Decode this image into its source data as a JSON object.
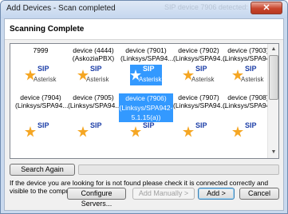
{
  "window": {
    "title": "Add Devices - Scan completed",
    "ghost_text": "SIP device 7906 detected: (Linksys...",
    "close_label": "✕"
  },
  "header": {
    "title": "Scanning Complete"
  },
  "device_icon": {
    "sip": "SIP",
    "brand": "Asterisk"
  },
  "devices": [
    {
      "label": "7999",
      "label2": ""
    },
    {
      "label": "device (4444)",
      "label2": "(AskoziaPBX)"
    },
    {
      "label": "device (7901)",
      "label2": "(Linksys/SPA94..."
    },
    {
      "label": "device (7902)",
      "label2": "(Linksys/SPA94..."
    },
    {
      "label": "device (7903)",
      "label2": "(Linksys/SPA94..."
    },
    {
      "label": "device (7904)",
      "label2": "(Linksys/SPA94..."
    },
    {
      "label": "device (7905)",
      "label2": "(Linksys/SPA94..."
    },
    {
      "label": "device (7906)",
      "label2": "(Linksys/SPA942-",
      "label3": "5.1.15(a))",
      "selected": true
    },
    {
      "label": "device (7907)",
      "label2": "(Linksys/SPA94..."
    },
    {
      "label": "device (7908)",
      "label2": "(Linksys/SPA94..."
    }
  ],
  "search_button": "Search Again",
  "help_text": "If the device you are looking for is not found please check it is connected correctly and visible to the computer.",
  "buttons": {
    "configure": "Configure Servers...",
    "add_manually": "Add Manually >",
    "add": "Add >",
    "cancel": "Cancel"
  },
  "colors": {
    "selection": "#3399ff",
    "sip_text": "#1d3fa8",
    "star": "#f5a623"
  }
}
